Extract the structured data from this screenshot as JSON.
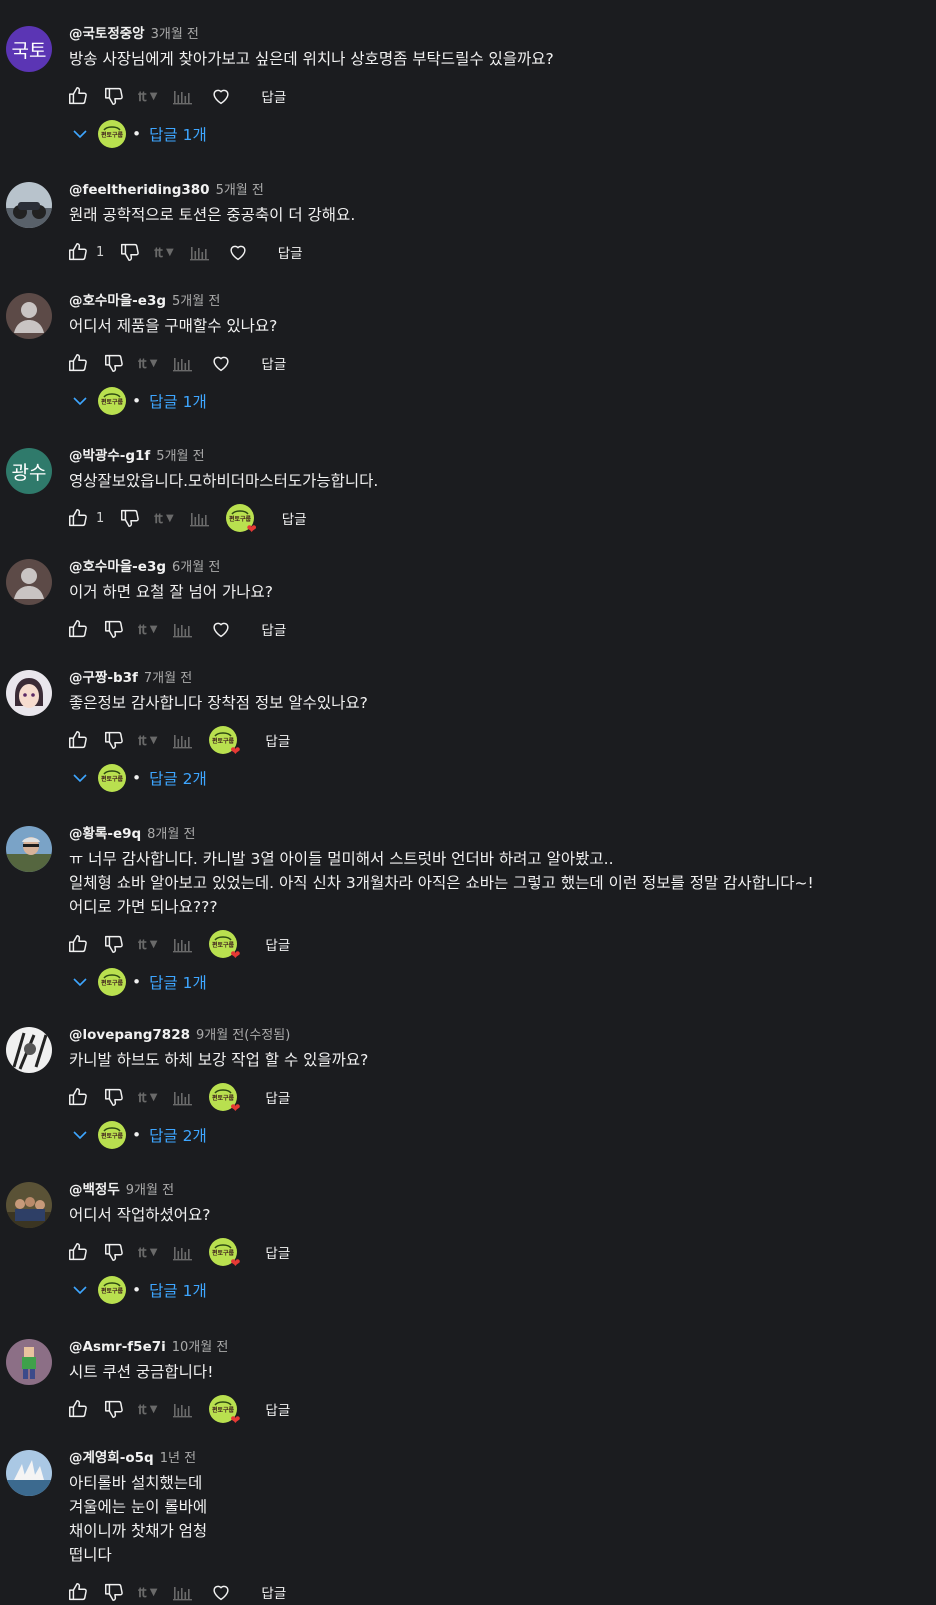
{
  "labels": {
    "reply": "답글",
    "replies_prefix": "답글",
    "replies_suffix": "개",
    "edited": "(수정됨)"
  },
  "colors": {
    "background": "#1b1c1f",
    "link_blue": "#3ea6ff",
    "creator_badge": "#b9e04f",
    "heart": "#e53935"
  },
  "comments": [
    {
      "author": "@국토정중앙",
      "time": "3개월 전",
      "avatar_text": "국토",
      "avatar_color": "#5b35b4",
      "text": "방송 사장님에게 찾아가보고 싶은데 위치나 상호명좀 부탁드릴수 있을까요?",
      "likes": "",
      "hearted": false,
      "reply_count": "1"
    },
    {
      "author": "@feeltheriding380",
      "time": "5개월 전",
      "avatar_icon": "motorcycle-photo",
      "text": "원래 공학적으로 토션은 중공축이 더 강해요.",
      "likes": "1",
      "hearted": false,
      "reply_count": ""
    },
    {
      "author": "@호수마을-e3g",
      "time": "5개월 전",
      "avatar_icon": "default-user-icon",
      "text": "어디서 제품을 구매할수 있나요?",
      "likes": "",
      "hearted": false,
      "reply_count": "1"
    },
    {
      "author": "@박광수-g1f",
      "time": "5개월 전",
      "avatar_text": "광수",
      "avatar_color": "#2f7a6b",
      "text": "영상잘보았읍니다.모하비더마스터도가능합니다.",
      "likes": "1",
      "hearted": true,
      "reply_count": ""
    },
    {
      "author": "@호수마을-e3g",
      "time": "6개월 전",
      "avatar_icon": "default-user-icon",
      "text": "이거 하면 요철 잘 넘어 가나요?",
      "likes": "",
      "hearted": false,
      "reply_count": ""
    },
    {
      "author": "@구짱-b3f",
      "time": "7개월 전",
      "avatar_icon": "anime-face-photo",
      "text": "좋은정보 감사합니다 장착점 정보 알수있나요?",
      "likes": "",
      "hearted": true,
      "reply_count": "2"
    },
    {
      "author": "@황록-e9q",
      "time": "8개월 전",
      "avatar_icon": "cyclist-photo",
      "text": "ㅠ 너무 감사합니다. 카니발 3열 아이들 멀미해서 스트럿바 언더바 하려고 알아봤고..\n일체형 쇼바 알아보고 있었는데. 아직 신차 3개월차라 아직은 쇼바는 그렇고 했는데 이런 정보를 정말 감사합니다~!\n어디로 가면 되나요???",
      "likes": "",
      "hearted": true,
      "reply_count": "1"
    },
    {
      "author": "@lovepang7828",
      "time": "9개월 전(수정됨)",
      "avatar_icon": "sketch-photo",
      "text": "카니발 하브도 하체 보강 작업 할 수 있을까요?",
      "likes": "",
      "hearted": true,
      "reply_count": "2"
    },
    {
      "author": "@백정두",
      "time": "9개월 전",
      "avatar_icon": "group-photo",
      "text": "어디서 작업하셨어요?",
      "likes": "",
      "hearted": true,
      "reply_count": "1"
    },
    {
      "author": "@Asmr-f5e7i",
      "time": "10개월 전",
      "avatar_icon": "pixel-character-photo",
      "text": "시트 쿠션 궁금합니다!",
      "likes": "",
      "hearted": true,
      "reply_count": ""
    },
    {
      "author": "@계영희-o5q",
      "time": "1년 전",
      "avatar_icon": "opera-house-photo",
      "text": "아티롤바 설치했는데\n겨울에는 눈이 롤바에\n채이니까 찻채가 엄청\n떱니다",
      "likes": "",
      "hearted": false,
      "reply_count": ""
    }
  ],
  "creator_badge_text": "편토구룹"
}
